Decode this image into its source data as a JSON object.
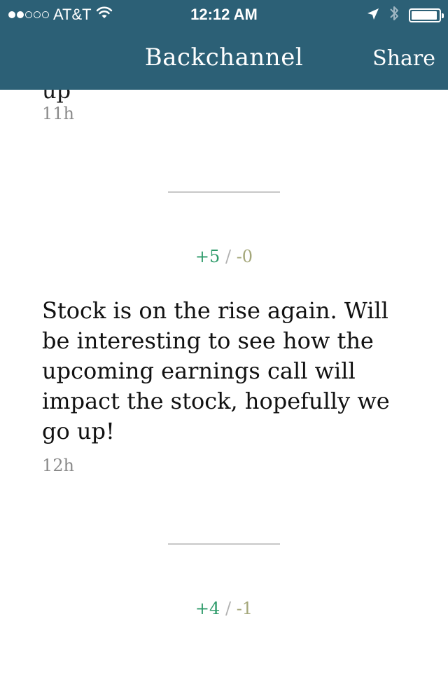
{
  "status_bar": {
    "carrier": "AT&T",
    "time": "12:12 AM",
    "signal_bars_filled": 2,
    "signal_bars_total": 5,
    "icons": [
      "wifi-icon",
      "location-arrow-icon",
      "bluetooth-icon",
      "battery-icon"
    ],
    "battery_level": 0.95
  },
  "nav": {
    "title": "Backchannel",
    "share_label": "Share",
    "background_color": "#2c6076"
  },
  "posts": [
    {
      "text": "up",
      "time": "11h"
    },
    {
      "votes_up": "+5",
      "votes_sep": "/",
      "votes_down": "-0",
      "text": "Stock is on the rise again. Will be interesting to see how the upcoming earnings call will impact the stock, hopefully we go up!",
      "time": "12h"
    },
    {
      "votes_up": "+4",
      "votes_sep": "/",
      "votes_down": "-1"
    }
  ],
  "colors": {
    "vote_up": "#2e9b6a",
    "vote_down": "#a4a77a",
    "timestamp": "#8a8a8a"
  }
}
